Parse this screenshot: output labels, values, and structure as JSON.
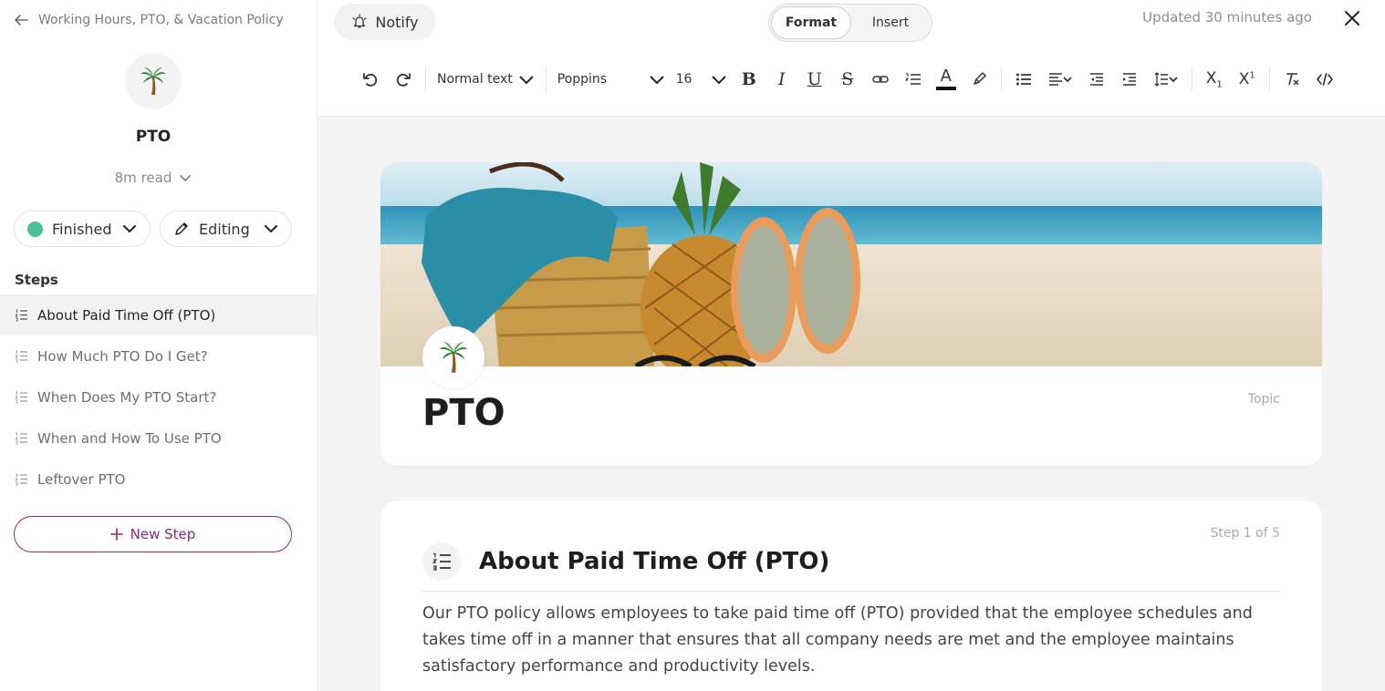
{
  "sidebar": {
    "back_label": "Working Hours, PTO, & Vacation Policy",
    "title": "PTO",
    "read_time": "8m read",
    "status_label": "Finished",
    "mode_label": "Editing",
    "steps_heading": "Steps",
    "steps": [
      {
        "label": "About Paid Time Off (PTO)",
        "active": true
      },
      {
        "label": "How Much PTO Do I Get?",
        "active": false
      },
      {
        "label": "When Does My PTO Start?",
        "active": false
      },
      {
        "label": "When and How To Use PTO",
        "active": false
      },
      {
        "label": "Leftover PTO",
        "active": false
      }
    ],
    "new_step_label": "New Step"
  },
  "topbar": {
    "notify_label": "Notify",
    "tabs": [
      {
        "label": "Format",
        "selected": true
      },
      {
        "label": "Insert",
        "selected": false
      }
    ],
    "updated_text": "Updated 30 minutes ago"
  },
  "toolbar": {
    "text_style": "Normal text",
    "font": "Poppins",
    "font_size": "16",
    "bold_glyph": "B",
    "italic_glyph": "I",
    "underline_glyph": "U",
    "strike_glyph": "S",
    "textcolor_glyph": "A",
    "subscript_glyph": "X",
    "subscript_mark": "1",
    "superscript_glyph": "X",
    "superscript_mark": "1"
  },
  "topic": {
    "title": "PTO",
    "type_label": "Topic"
  },
  "step": {
    "counter": "Step 1 of 5",
    "heading": "About Paid Time Off (PTO)",
    "body": "Our PTO policy allows employees to take paid time off (PTO) provided that the employee schedules and takes time off in a manner that ensures that all company needs are met and the employee maintains satisfactory performance and productivity levels."
  },
  "colors": {
    "accent": "#8a2b6f",
    "status_finished": "#49bf95"
  },
  "icons": [
    "arrow-left-icon",
    "palm-tree-icon",
    "chevron-down-icon",
    "pencil-icon",
    "numbered-list-icon",
    "plus-icon",
    "bell-icon",
    "close-icon"
  ]
}
